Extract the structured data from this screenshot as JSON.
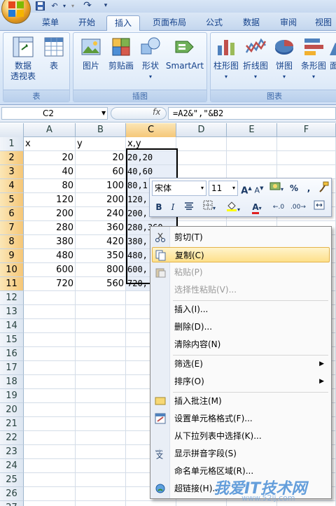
{
  "tabs": [
    "菜单",
    "开始",
    "插入",
    "页面布局",
    "公式",
    "数据",
    "审阅",
    "视图"
  ],
  "active_tab": "插入",
  "ribbon": {
    "groups": [
      {
        "label": "表",
        "buttons": [
          "数据\n透视表",
          "表"
        ]
      },
      {
        "label": "插图",
        "buttons": [
          "图片",
          "剪贴画",
          "形状",
          "SmartArt"
        ]
      },
      {
        "label": "图表",
        "buttons": [
          "柱形图",
          "折线图",
          "饼图",
          "条形图",
          "面"
        ]
      }
    ]
  },
  "formula_bar": {
    "name_box": "C2",
    "fx": "fx",
    "formula": "=A2&\",\"&B2"
  },
  "columns": [
    "A",
    "B",
    "C",
    "D",
    "E",
    "F"
  ],
  "selected_column": "C",
  "rows": [
    {
      "n": "1",
      "a": "x",
      "b": "y",
      "c": "x,y"
    },
    {
      "n": "2",
      "a": "20",
      "b": "20",
      "c": "20,20"
    },
    {
      "n": "3",
      "a": "40",
      "b": "60",
      "c": "40,60"
    },
    {
      "n": "4",
      "a": "80",
      "b": "100",
      "c": "80,1"
    },
    {
      "n": "5",
      "a": "120",
      "b": "200",
      "c": "120,"
    },
    {
      "n": "6",
      "a": "200",
      "b": "240",
      "c": "200,"
    },
    {
      "n": "7",
      "a": "280",
      "b": "360",
      "c": "280,360"
    },
    {
      "n": "8",
      "a": "380",
      "b": "420",
      "c": "380,"
    },
    {
      "n": "9",
      "a": "480",
      "b": "350",
      "c": "480,"
    },
    {
      "n": "10",
      "a": "600",
      "b": "800",
      "c": "600,"
    },
    {
      "n": "11",
      "a": "720",
      "b": "560",
      "c": "720,"
    },
    {
      "n": "12"
    },
    {
      "n": "13"
    },
    {
      "n": "14"
    },
    {
      "n": "15"
    },
    {
      "n": "16"
    },
    {
      "n": "17"
    },
    {
      "n": "18"
    },
    {
      "n": "19"
    },
    {
      "n": "20"
    },
    {
      "n": "21"
    },
    {
      "n": "22"
    },
    {
      "n": "23"
    },
    {
      "n": "24"
    },
    {
      "n": "25"
    },
    {
      "n": "26"
    },
    {
      "n": "27"
    }
  ],
  "mini_toolbar": {
    "font": "宋体",
    "size": "11",
    "grow": "A",
    "shrink": "A",
    "percent": "%",
    "comma": ",",
    "bold": "B",
    "italic": "I",
    "font_color": "A"
  },
  "context_menu": [
    {
      "label": "剪切(T)",
      "icon": "scissors-icon",
      "state": "normal"
    },
    {
      "label": "复制(C)",
      "icon": "copy-icon",
      "state": "highlight"
    },
    {
      "label": "粘贴(P)",
      "icon": "paste-icon",
      "state": "disabled"
    },
    {
      "label": "选择性粘贴(V)...",
      "icon": "",
      "state": "disabled"
    },
    {
      "label": "插入(I)...",
      "icon": "",
      "state": "normal"
    },
    {
      "label": "删除(D)...",
      "icon": "",
      "state": "normal"
    },
    {
      "label": "清除内容(N)",
      "icon": "",
      "state": "normal"
    },
    {
      "label": "筛选(E)",
      "icon": "",
      "state": "submenu"
    },
    {
      "label": "排序(O)",
      "icon": "",
      "state": "submenu"
    },
    {
      "label": "插入批注(M)",
      "icon": "comment-icon",
      "state": "normal"
    },
    {
      "label": "设置单元格格式(F)...",
      "icon": "format-cells-icon",
      "state": "normal"
    },
    {
      "label": "从下拉列表中选择(K)...",
      "icon": "",
      "state": "normal"
    },
    {
      "label": "显示拼音字段(S)",
      "icon": "phonetic-icon",
      "state": "normal"
    },
    {
      "label": "命名单元格区域(R)...",
      "icon": "",
      "state": "normal"
    },
    {
      "label": "超链接(H)...",
      "icon": "hyperlink-icon",
      "state": "normal"
    }
  ],
  "watermark": {
    "main": "我爱IT技术网",
    "sub": "www.52ij.com"
  },
  "colors": {
    "accent": "#15428b",
    "selection": "#f5c778",
    "menu_highlight": "#fde08a"
  }
}
